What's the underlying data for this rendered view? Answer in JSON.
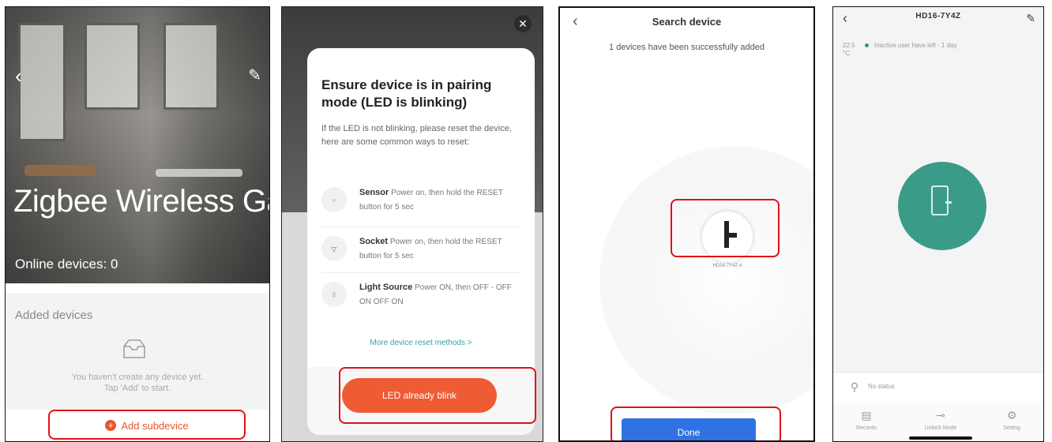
{
  "panel1": {
    "title": "Zigbee Wireless Gate...",
    "online_devices": "Online devices: 0",
    "added_devices_label": "Added devices",
    "empty_message_line1": "You haven't create any device yet.",
    "empty_message_line2": "Tap 'Add' to start.",
    "add_subdevice_label": "Add subdevice"
  },
  "panel2": {
    "heading": "Ensure device is in pairing mode (LED is blinking)",
    "description": "If the LED is not blinking, please reset the device, here are some common ways to reset:",
    "items": [
      {
        "name": "Sensor",
        "text": "Power on, then hold the RESET button for 5 sec",
        "icon": "sensor-icon"
      },
      {
        "name": "Socket",
        "text": "Power on, then hold the RESET button for 5 sec",
        "icon": "socket-icon"
      },
      {
        "name": "Light Source",
        "text": "Power ON, then OFF - OFF ON OFF ON",
        "icon": "bulb-icon"
      }
    ],
    "more_link": "More device reset methods >",
    "confirm_button": "LED already blink"
  },
  "panel3": {
    "title": "Search device",
    "status": "1 devices have been successfully added",
    "device_caption": "HD16-7Y4Z-4",
    "done_button": "Done"
  },
  "panel4": {
    "title": "HD16-7Y4Z",
    "side_label_line1": "22.5",
    "side_label_line2": "°C",
    "status_text": "Inactive user have left - 1 day",
    "no_status": "No status",
    "tabs": [
      "Records",
      "Unlock Mode",
      "Setting"
    ]
  },
  "colors": {
    "highlight": "#e01018",
    "orange": "#ef5b33",
    "blue": "#2f72e4",
    "teal": "#3a9c88"
  }
}
